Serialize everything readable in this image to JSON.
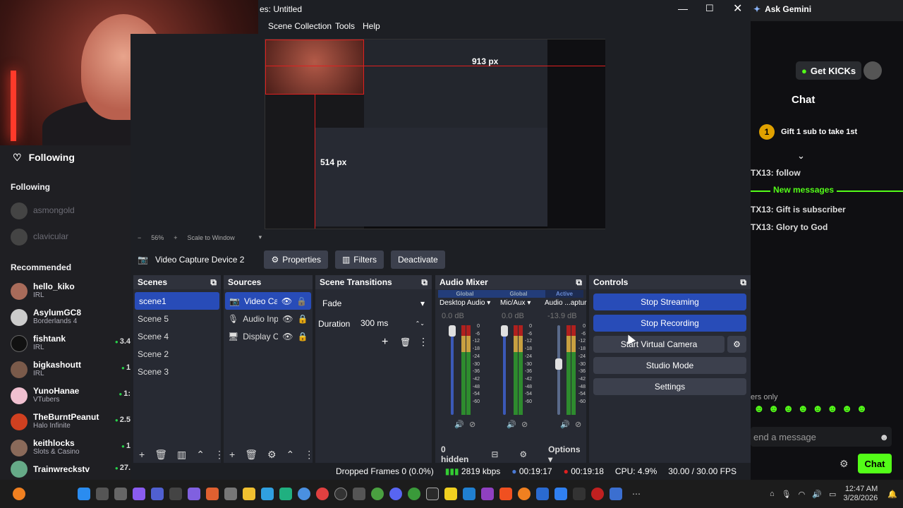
{
  "obs": {
    "window_title": "es: Untitled",
    "menu": [
      "Scene Collection",
      "Tools",
      "Help"
    ],
    "zoom": "56%",
    "scale_mode": "Scale to Window",
    "preview_labels": [
      "913 px",
      "514 px"
    ],
    "source_toolbar": {
      "source_name": "Video Capture Device 2",
      "properties": "Properties",
      "filters": "Filters",
      "deactivate": "Deactivate"
    },
    "scenes": {
      "title": "Scenes",
      "items": [
        "scene1",
        "Scene 5",
        "Scene 4",
        "Scene 2",
        "Scene 3"
      ],
      "selected": "scene1"
    },
    "sources": {
      "title": "Sources",
      "items": [
        "Video Cap",
        "Audio Inp",
        "Display Ca"
      ]
    },
    "transitions": {
      "title": "Scene Transitions",
      "type": "Fade",
      "duration_label": "Duration",
      "duration_value": "300 ms"
    },
    "mixer": {
      "title": "Audio Mixer",
      "strips": [
        {
          "tag": "Global",
          "name": "Desktop Audio",
          "db": "0.0 dB"
        },
        {
          "tag": "Global",
          "name": "Mic/Aux",
          "db": "0.0 dB"
        },
        {
          "tag": "Active",
          "name": "Audio ...aptur",
          "db": "-13.9 dB"
        }
      ],
      "scale": [
        "0",
        "-6",
        "-12",
        "-18",
        "-24",
        "-30",
        "-36",
        "-42",
        "-48",
        "-54",
        "-60"
      ],
      "hidden": "0 hidden",
      "options": "Options"
    },
    "controls": {
      "title": "Controls",
      "stop_streaming": "Stop Streaming",
      "stop_recording": "Stop Recording",
      "start_virtual_camera": "Start Virtual Camera",
      "studio_mode": "Studio Mode",
      "settings": "Settings"
    },
    "status": {
      "dropped": "Dropped Frames 0 (0.0%)",
      "bitrate": "2819 kbps",
      "stream_time": "00:19:17",
      "rec_time": "00:19:18",
      "cpu": "CPU: 4.9%",
      "fps": "30.00 / 30.00 FPS"
    }
  },
  "twitch_sidebar": {
    "header": "Following",
    "following_label": "Following",
    "offline": [
      "asmongold",
      "clavicular"
    ],
    "recommended_label": "Recommended",
    "channels": [
      {
        "name": "hello_kiko",
        "game": "IRL",
        "viewers": ""
      },
      {
        "name": "AsylumGC8",
        "game": "Borderlands 4",
        "viewers": ""
      },
      {
        "name": "fishtank",
        "game": "IRL",
        "viewers": "3.4"
      },
      {
        "name": "bigkashoutt",
        "game": "IRL",
        "viewers": "1"
      },
      {
        "name": "YunoHanae",
        "game": "VTubers",
        "viewers": "1:"
      },
      {
        "name": "TheBurntPeanut",
        "game": "Halo Infinite",
        "viewers": "2.5"
      },
      {
        "name": "keithlocks",
        "game": "Slots & Casino",
        "viewers": "1"
      },
      {
        "name": "Trainwreckstv",
        "game": "",
        "viewers": "27."
      }
    ]
  },
  "browser": {
    "gemini": "Ask Gemini"
  },
  "chat": {
    "get_kicks": "Get KICKs",
    "title": "Chat",
    "gift_banner": "Gift 1 sub to take 1st",
    "gift_count": "1",
    "messages": [
      "TX13: follow",
      "TX13: Gift is subscriber",
      "TX13: Glory to God"
    ],
    "new_messages": "New messages",
    "subs_only": "ers only",
    "input_placeholder": "end a message",
    "send": "Chat"
  },
  "taskbar": {
    "time": "12:47 AM",
    "date": "3/28/2026"
  },
  "colors": {
    "obs_bg": "#1d1f24",
    "obs_accent": "#284cb8",
    "kick_green": "#53fc18",
    "live_dot": "#28d14a"
  }
}
